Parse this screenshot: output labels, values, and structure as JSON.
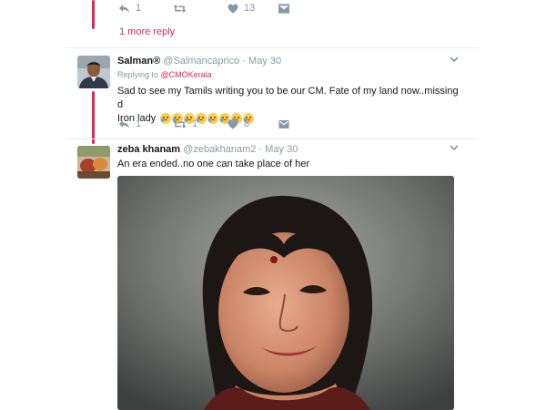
{
  "top_actions": {
    "reply_count": "1",
    "retweet_count": "",
    "like_count": "13"
  },
  "more_replies": {
    "label": "1 more reply"
  },
  "tweets": [
    {
      "name": "Salman®",
      "handle": "@Salmancaprico",
      "separator": "·",
      "time": "May 30",
      "replying_prefix": "Replying to",
      "replying_to": "@CMOKerala",
      "text_line1": "Sad to see my Tamils writing you to be our CM. Fate of my land now..missing d",
      "text_line2": "Iron lady",
      "emoji_count": 8,
      "reply_count": "1",
      "retweet_count": "1",
      "like_count": "8"
    },
    {
      "name": "zeba khanam",
      "handle": "@zebakhanam2",
      "separator": "·",
      "time": "May 30",
      "text": "An era ended..no one can take place of her"
    }
  ],
  "colors": {
    "accent": "#e0245e",
    "muted": "#8899a6",
    "text": "#14171a",
    "separator": "#e6ecf0"
  },
  "icons": [
    "reply-icon",
    "retweet-icon",
    "heart-icon",
    "message-icon",
    "chevron-down-icon",
    "crying-face-emoji"
  ]
}
